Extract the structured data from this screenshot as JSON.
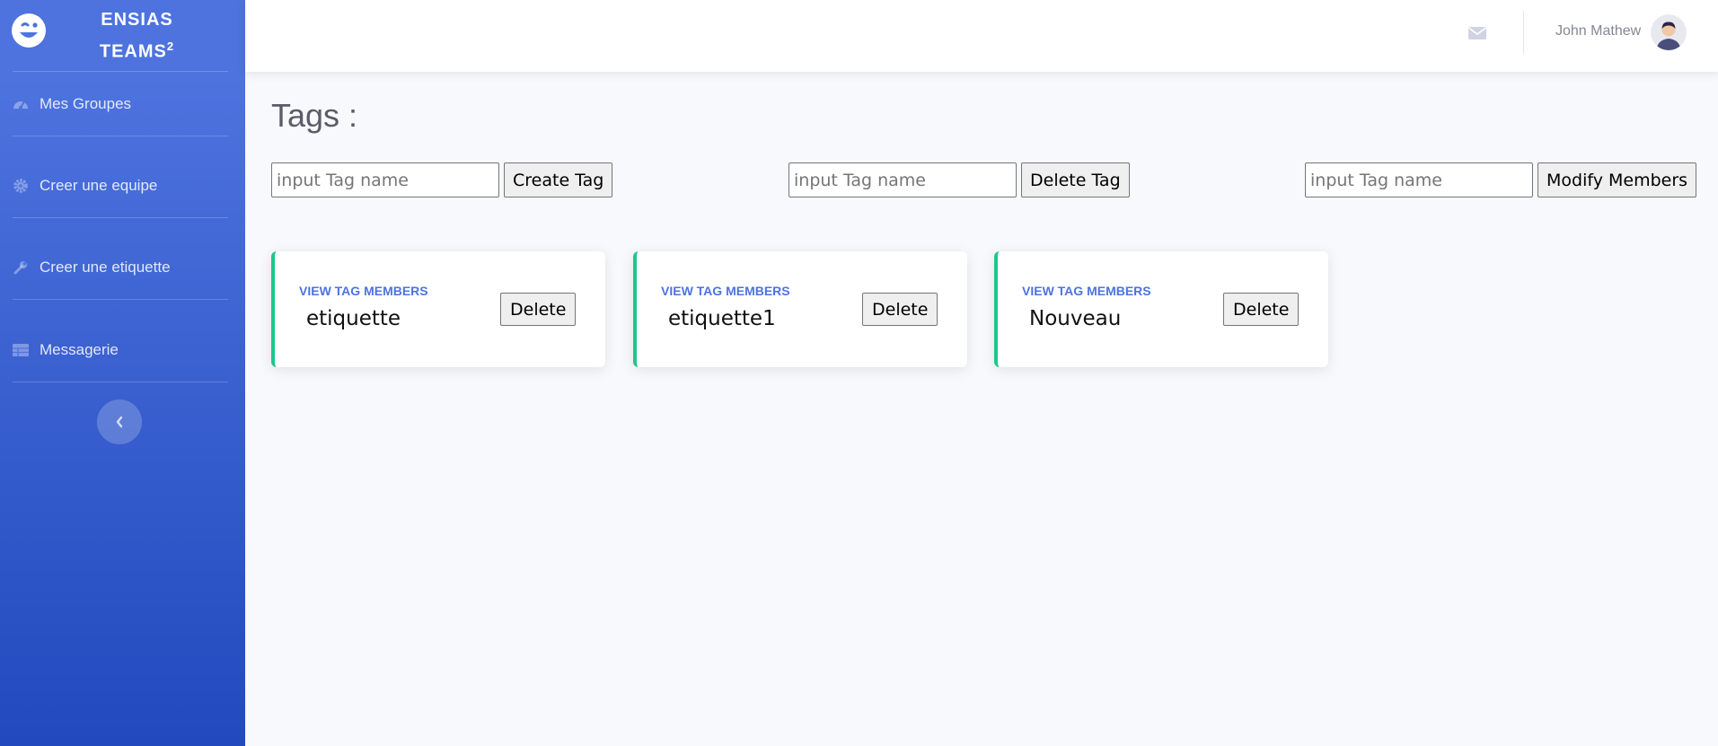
{
  "brand": {
    "line1": "ENSIAS",
    "line2": "TEAMS",
    "sup": "2"
  },
  "sidebar": {
    "items": [
      {
        "label": "Mes Groupes",
        "icon": "tachometer-icon"
      },
      {
        "label": "Creer une equipe",
        "icon": "gear-icon"
      },
      {
        "label": "Creer une etiquette",
        "icon": "wrench-icon"
      },
      {
        "label": "Messagerie",
        "icon": "table-icon"
      }
    ]
  },
  "topbar": {
    "user_name": "John Mathew"
  },
  "page": {
    "title": "Tags :"
  },
  "forms": [
    {
      "placeholder": "input Tag name",
      "button": "Create Tag"
    },
    {
      "placeholder": "input Tag name",
      "button": "Delete Tag"
    },
    {
      "placeholder": "input Tag name",
      "button": "Modify Members"
    }
  ],
  "tags": [
    {
      "link": "VIEW TAG MEMBERS",
      "name": "etiquette",
      "button": "Delete"
    },
    {
      "link": "VIEW TAG MEMBERS",
      "name": "etiquette1",
      "button": "Delete"
    },
    {
      "link": "VIEW TAG MEMBERS",
      "name": "Nouveau",
      "button": "Delete"
    }
  ],
  "colors": {
    "primary": "#4e73df",
    "success": "#1cc88a",
    "sidebar_end": "#224abe"
  }
}
